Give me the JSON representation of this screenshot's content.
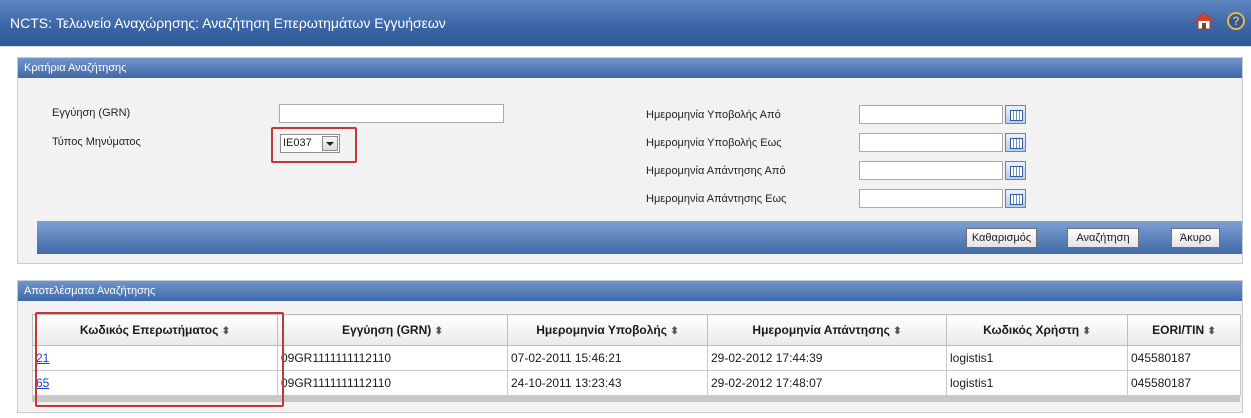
{
  "header": {
    "title": "NCTS: Τελωνείο Αναχώρησης: Αναζήτηση Επερωτημάτων Εγγυήσεων",
    "home_icon": "home-icon",
    "help_icon": "help-icon",
    "help_glyph": "?"
  },
  "criteria": {
    "title": "Κριτήρια Αναζήτησης",
    "grn_label": "Εγγύηση (GRN)",
    "grn_value": "",
    "message_type_label": "Τύπος Μηνύματος",
    "message_type_value": "IE037",
    "submit_from_label": "Ημερομηνία Υποβολής Από",
    "submit_to_label": "Ημερομηνία Υποβολής Εως",
    "reply_from_label": "Ημερομηνία Απάντησης Από",
    "reply_to_label": "Ημερομηνία Απάντησης Εως",
    "buttons": {
      "clear": "Καθαρισμός",
      "search": "Αναζήτηση",
      "cancel": "Άκυρο"
    }
  },
  "results": {
    "title": "Αποτελέσματα Αναζήτησης",
    "sort_glyph": "⬍",
    "columns": [
      "Κωδικός Επερωτήματος",
      "Εγγύηση (GRN)",
      "Ημερομηνία Υποβολής",
      "Ημερομηνία Απάντησης",
      "Κωδικός Χρήστη",
      "EORI/TIN"
    ],
    "rows": [
      [
        "21",
        "09GR1111111112110",
        "07-02-2011 15:46:21",
        "29-02-2012 17:44:39",
        "logistis1",
        "045580187"
      ],
      [
        "65",
        "09GR1111111112110",
        "24-10-2011 13:23:43",
        "29-02-2012 17:48:07",
        "logistis1",
        "045580187"
      ]
    ]
  },
  "colors": {
    "header_blue": "#3c66a6",
    "highlight_red": "#c4363a",
    "link_blue": "#1a3fc9"
  }
}
